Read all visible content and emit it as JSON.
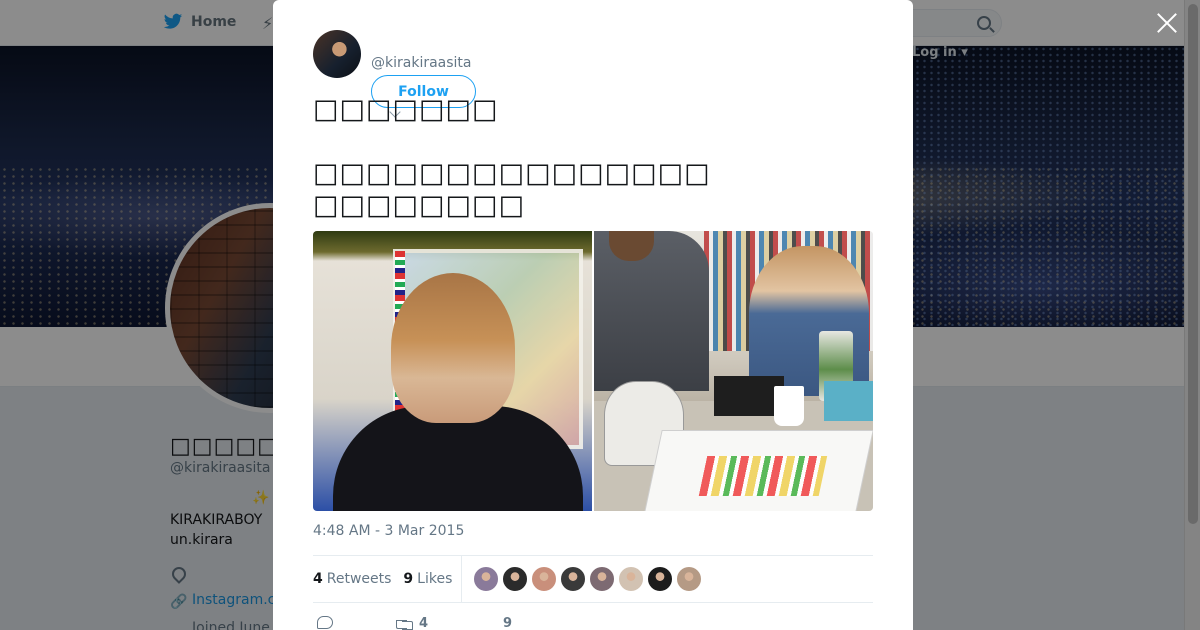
{
  "topbar": {
    "home_label": "Home",
    "login_label": "Log in"
  },
  "profile": {
    "display_name": "□□□□□□□□",
    "handle": "@kirakiraasita",
    "bio_line1": "KIRAKIRABOY",
    "bio_line2": "un.kirara",
    "website": "Instagram.c",
    "joined": "Joined June"
  },
  "tweet": {
    "handle": "@kirakiraasita",
    "follow_label": "Follow",
    "text": "□□□□□□□\n\n□□□□□□□□□□□□□□□\n□□□□□□□□",
    "timestamp": "4:48 AM - 3 Mar 2015",
    "retweets": {
      "count": "4",
      "label": "Retweets"
    },
    "likes": {
      "count": "9",
      "label": "Likes"
    },
    "actions": {
      "retweet_count": "4",
      "like_count": "9"
    },
    "liker_avatar_colors": [
      "#8a7a9a",
      "#2b2b2b",
      "#c98f7b",
      "#3a3a3a",
      "#7d6a72",
      "#d2c2b2",
      "#1c1c1c",
      "#b59a85"
    ]
  },
  "colors": {
    "accent": "#1da1f2",
    "link": "#1b95e0",
    "secondary_text": "#657786"
  }
}
